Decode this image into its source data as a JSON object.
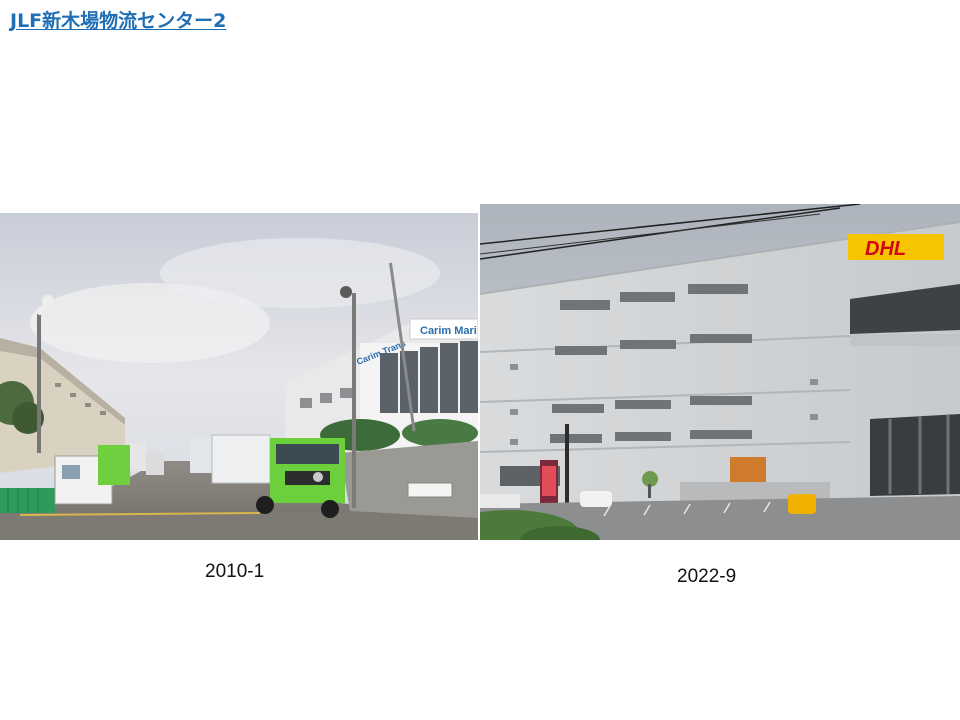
{
  "title": {
    "text": "JLF新木場物流センター2",
    "color": "#1f6fb5"
  },
  "photos": [
    {
      "caption": "2010-1",
      "signs": [
        "Carim Mari",
        "Carim Trans"
      ]
    },
    {
      "caption": "2022-9",
      "signs": [
        "DHL"
      ]
    }
  ]
}
